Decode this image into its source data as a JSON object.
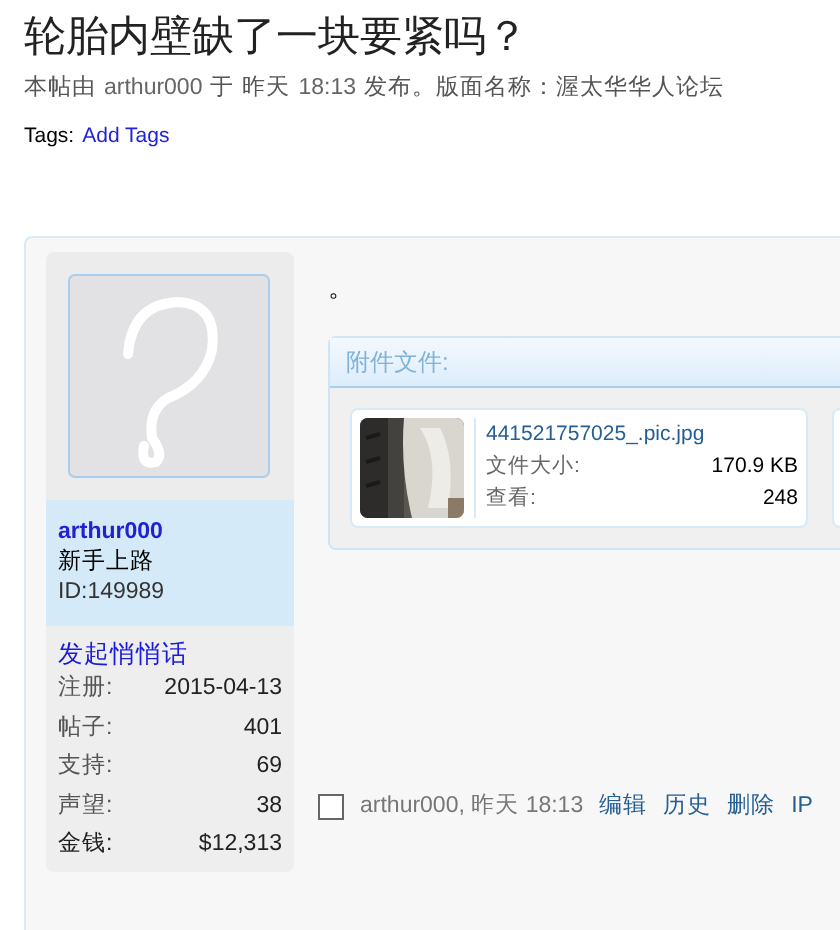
{
  "title": "轮胎内壁缺了一块要紧吗？",
  "meta": {
    "prefix": "本帖由",
    "author": "arthur000",
    "on": "于",
    "day": "昨天",
    "time": "18:13",
    "suffix": "发布。版面名称：渥太华华人论坛"
  },
  "tags": {
    "label": "Tags:",
    "link": "Add Tags"
  },
  "post": {
    "user": {
      "name": "arthur000",
      "rank": "新手上路",
      "id": "ID:149989",
      "pm_link": "发起悄悄话",
      "stats": [
        {
          "label": "注册:",
          "value": "2015-04-13"
        },
        {
          "label": "帖子:",
          "value": "401"
        },
        {
          "label": "支持:",
          "value": "69"
        },
        {
          "label": "声望:",
          "value": "38"
        },
        {
          "label": "金钱:",
          "value": "$12,313"
        }
      ]
    },
    "body": "。",
    "attachments": {
      "header": "附件文件:",
      "files": [
        {
          "kind": "picture",
          "filename": "441521757025_.pic.jpg",
          "size_label": "文件大小:",
          "size": "170.9 KB",
          "views_label": "查看:",
          "views": "248"
        }
      ]
    },
    "footer": {
      "checked": false,
      "byline": "arthur000, 昨天 18:13",
      "actions": [
        "编辑",
        "历史",
        "删除",
        "IP"
      ]
    }
  }
}
